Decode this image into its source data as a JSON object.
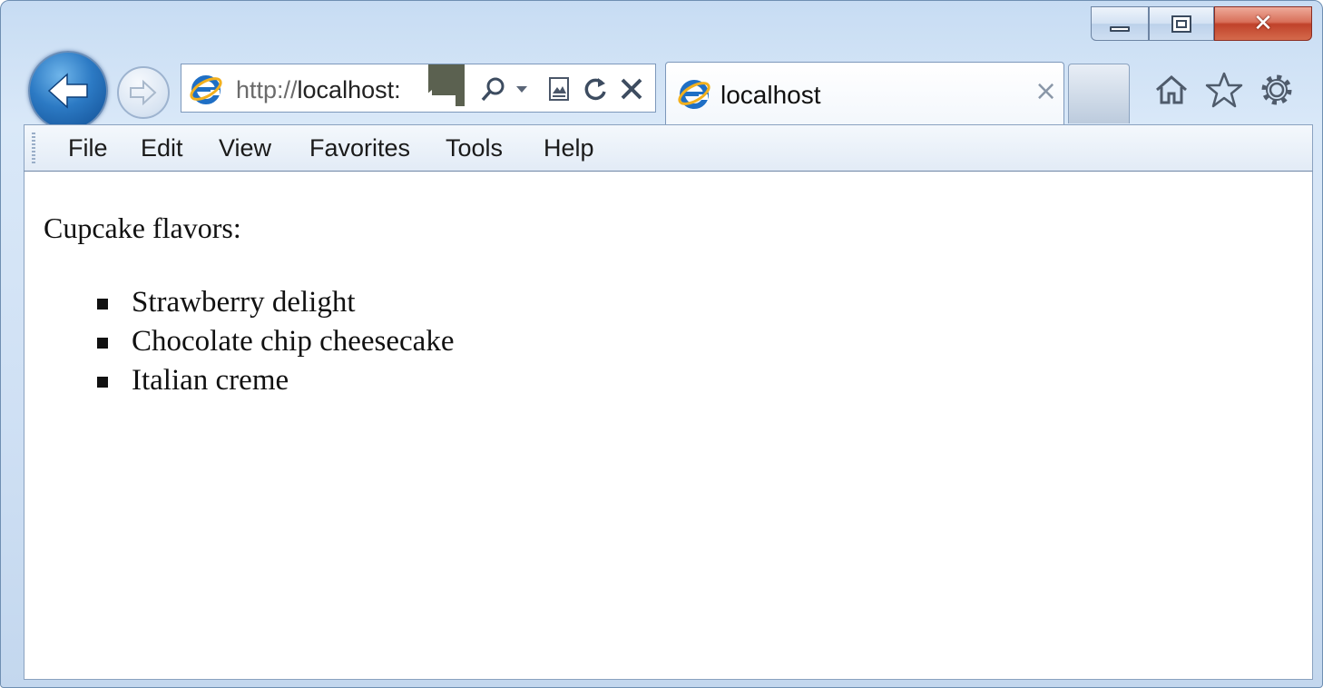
{
  "window": {
    "caption_buttons": [
      "minimize",
      "maximize",
      "close"
    ]
  },
  "nav": {
    "back_icon": "back-arrow-icon",
    "forward_icon": "forward-arrow-icon"
  },
  "address_bar": {
    "url_protocol": "http://",
    "url_host": "localhost:",
    "icons": [
      "search-icon",
      "dropdown-icon",
      "compatibility-icon",
      "refresh-icon",
      "stop-icon"
    ]
  },
  "tab": {
    "title": "localhost",
    "close_glyph": "×"
  },
  "toolbar_icons": [
    "home-icon",
    "favorites-star-icon",
    "gear-icon"
  ],
  "menu": {
    "items": [
      "File",
      "Edit",
      "View",
      "Favorites",
      "Tools",
      "Help"
    ]
  },
  "content": {
    "heading": "Cupcake flavors:",
    "flavors": [
      "Strawberry delight",
      "Chocolate chip cheesecake",
      "Italian creme"
    ]
  },
  "colors": {
    "frame": "#c7dcf3",
    "close_button": "#c0422a",
    "back_button": "#2c7ac4",
    "ie_logo": "#1f6fc5"
  }
}
